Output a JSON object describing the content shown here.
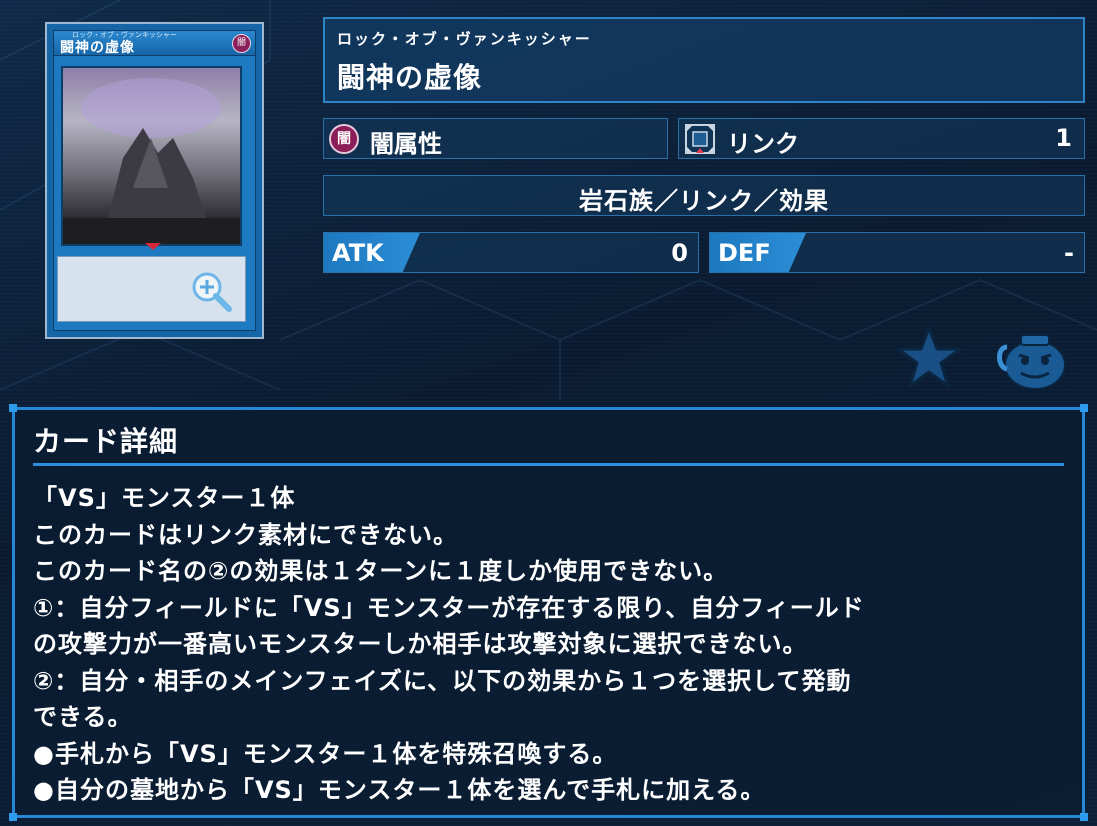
{
  "card_image": {
    "name": "闘神の虚像",
    "ruby": "ロック・オブ・ヴァンキッシャー",
    "attribute_mark": "闇"
  },
  "header": {
    "ruby": "ロック・オブ・ヴァンキッシャー",
    "name": "闘神の虚像"
  },
  "attribute": {
    "icon": "dark-attribute-icon",
    "icon_glyph": "闇",
    "label": "闇属性",
    "color": "#8b1e58"
  },
  "link": {
    "icon": "link-rating-icon",
    "label": "リンク",
    "value": "1"
  },
  "type_line": "岩石族／リンク／効果",
  "stats": {
    "atk_label": "ATK",
    "atk_value": "0",
    "def_label": "DEF",
    "def_value": "-"
  },
  "actions": {
    "favorite_icon": "star-icon",
    "pot_icon": "pot-of-greed-icon"
  },
  "details": {
    "title": "カード詳細",
    "lines": [
      "「VS」モンスター１体",
      "このカードはリンク素材にできない。",
      "このカード名の②の効果は１ターンに１度しか使用できない。",
      "①：自分フィールドに「VS」モンスターが存在する限り、自分フィールド",
      "の攻撃力が一番高いモンスターしか相手は攻撃対象に選択できない。",
      "②：自分・相手のメインフェイズに、以下の効果から１つを選択して発動",
      "できる。",
      "●手札から「VS」モンスター１体を特殊召喚する。",
      "●自分の墓地から「VS」モンスター１体を選んで手札に加える。"
    ]
  },
  "colors": {
    "accent": "#2587d6",
    "background": "#0b1d33",
    "text": "#ffffff"
  }
}
